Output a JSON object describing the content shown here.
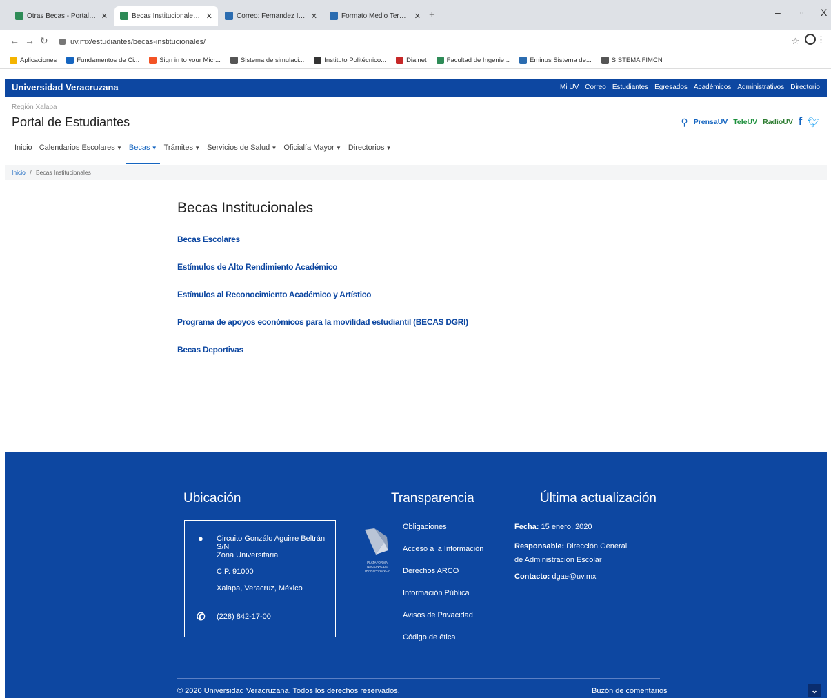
{
  "browser": {
    "tabs": [
      {
        "title": "Otras Becas - Portal de Estudiant",
        "active": false
      },
      {
        "title": "Becas Institucionales - Portal de",
        "active": true
      },
      {
        "title": "Correo: Fernandez Infanzon Ric",
        "active": false
      },
      {
        "title": "Formato Medio Termino.doc",
        "active": false
      }
    ],
    "new_tab": "+",
    "window_controls": {
      "minimize": "–",
      "maximize": "▫",
      "close": "X"
    },
    "url": "uv.mx/estudiantes/becas-institucionales/",
    "bookmarks": [
      {
        "label": "Aplicaciones",
        "color": "#f4b400"
      },
      {
        "label": "Fundamentos de Ci...",
        "color": "#1565c0"
      },
      {
        "label": "Sign in to your Micr...",
        "color": "#f35325"
      },
      {
        "label": "Sistema de simulaci...",
        "color": "#555555"
      },
      {
        "label": "Instituto Politécnico...",
        "color": "#333333"
      },
      {
        "label": "Dialnet",
        "color": "#c62828"
      },
      {
        "label": "Facultad de Ingenie...",
        "color": "#2e8b57"
      },
      {
        "label": "Eminus Sistema de...",
        "color": "#2b6cb0"
      },
      {
        "label": "SISTEMA FIMCN",
        "color": "#555555"
      }
    ]
  },
  "site": {
    "brand": "Universidad Veracruzana",
    "top_links": [
      "Mi UV",
      "Correo",
      "Estudiantes",
      "Egresados",
      "Académicos",
      "Administrativos",
      "Directorio"
    ],
    "region": "Región Xalapa",
    "portal_title": "Portal de Estudiantes",
    "media": {
      "prensa": "PrensaUV",
      "tele": "TeleUV",
      "radio": "RadioUV"
    },
    "nav": [
      {
        "label": "Inicio",
        "dropdown": false,
        "active": false
      },
      {
        "label": "Calendarios Escolares",
        "dropdown": true,
        "active": false
      },
      {
        "label": "Becas",
        "dropdown": true,
        "active": true
      },
      {
        "label": "Trámites",
        "dropdown": true,
        "active": false
      },
      {
        "label": "Servicios de Salud",
        "dropdown": true,
        "active": false
      },
      {
        "label": "Oficialía Mayor",
        "dropdown": true,
        "active": false
      },
      {
        "label": "Directorios",
        "dropdown": true,
        "active": false
      }
    ],
    "breadcrumb": {
      "home": "Inicio",
      "separator": "/",
      "current": "Becas Institucionales"
    }
  },
  "content": {
    "title": "Becas Institucionales",
    "links": [
      "Becas Escolares",
      "Estímulos de Alto Rendimiento Académico",
      "Estímulos al Reconocimiento Académico y Artístico",
      "Programa de apoyos económicos para la movilidad estudiantil (BECAS DGRI)",
      "Becas Deportivas"
    ]
  },
  "footer": {
    "ubicacion": {
      "title": "Ubicación",
      "address": [
        "Circuito Gonzálo Aguirre Beltrán S/N",
        "Zona Universitaria",
        "C.P. 91000",
        "Xalapa, Veracruz, México"
      ],
      "phone": "(228) 842-17-00"
    },
    "transparencia": {
      "title": "Transparencia",
      "logo_text": [
        "PLATAFORMA",
        "NACIONAL DE",
        "TRANSPARENCIA"
      ],
      "links": [
        "Obligaciones",
        "Acceso a la Información",
        "Derechos ARCO",
        "Información Pública",
        "Avisos de Privacidad",
        "Código de ética"
      ]
    },
    "actualizacion": {
      "title": "Última actualización",
      "fecha_label": "Fecha:",
      "fecha": "15 enero, 2020",
      "responsable_label": "Responsable:",
      "responsable": "Dirección General de Administración Escolar",
      "contacto_label": "Contacto:",
      "contacto": "dgae@uv.mx"
    },
    "copyright": "© 2020 Universidad Veracruzana. Todos los derechos reservados.",
    "buzon": "Buzón de comentarios",
    "to_top": "⌄"
  },
  "colors": {
    "brand_blue": "#0d47a1",
    "link_blue": "#1565c0"
  }
}
